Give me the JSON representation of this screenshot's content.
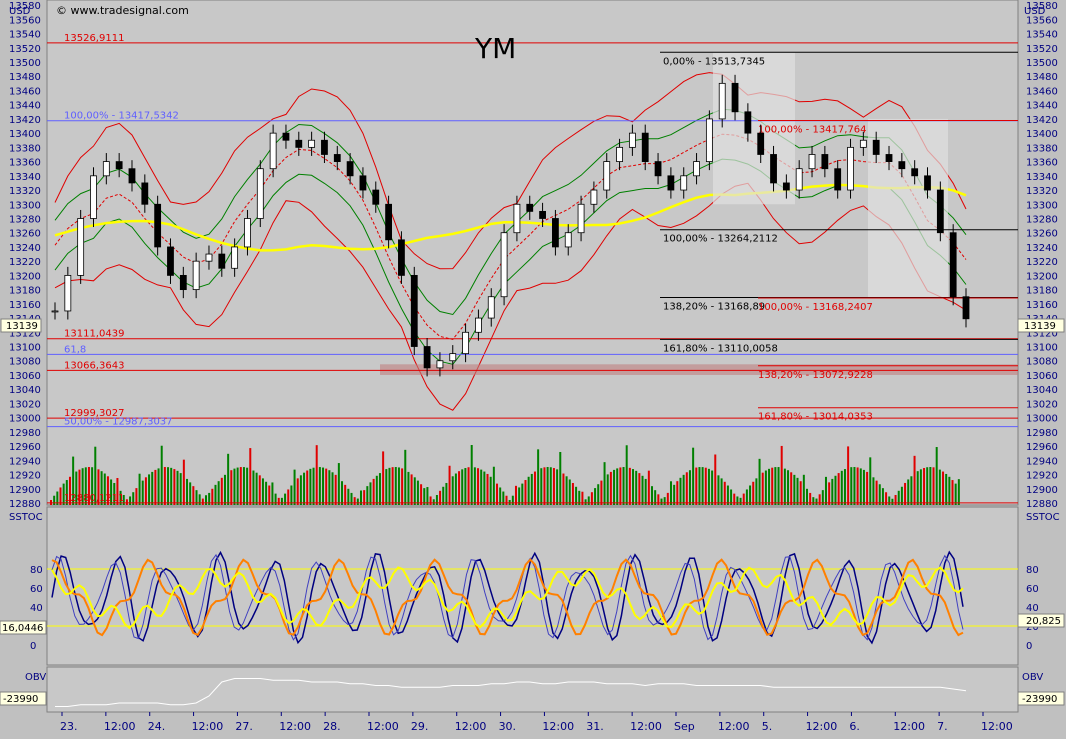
{
  "header": {
    "currency_left": "USD",
    "currency_right": "USD",
    "copyright": "© www.tradesignal.com",
    "symbol": "YM"
  },
  "price_panel": {
    "y_ticks": [
      13580,
      13560,
      13540,
      13520,
      13500,
      13480,
      13460,
      13440,
      13420,
      13400,
      13380,
      13360,
      13340,
      13320,
      13300,
      13280,
      13260,
      13240,
      13220,
      13200,
      13180,
      13160,
      13140,
      13120,
      13100,
      13080,
      13060,
      13040,
      13020,
      13000,
      12980,
      12960,
      12940,
      12920,
      12900,
      12880
    ],
    "current_price_label": "13139",
    "fib_levels": [
      {
        "label": "13526,9111",
        "value": 13526.9,
        "color": "#e00000",
        "style": "red"
      },
      {
        "label": "100,00% - 13417,5342",
        "value": 13417.5,
        "color": "#6060ff",
        "style": "blue"
      },
      {
        "label": "13111,0439",
        "value": 13111.0,
        "color": "#e00000",
        "style": "red"
      },
      {
        "label": "61,8",
        "value": 13089,
        "color": "#6060ff",
        "style": "blue"
      },
      {
        "label": "13066,3643",
        "value": 13066.4,
        "color": "#e00000",
        "style": "red"
      },
      {
        "label": "12999,3027",
        "value": 12999.3,
        "color": "#e00000",
        "style": "red"
      },
      {
        "label": "50,00% - 12987,3037",
        "value": 12987.3,
        "color": "#6060ff",
        "style": "blue"
      },
      {
        "label": "12880,1211",
        "value": 12880.1,
        "color": "#e00000",
        "style": "red"
      }
    ],
    "right_fibs": [
      {
        "label": "0,00% - 13513,7345",
        "value": 13513.7,
        "color": "#000000"
      },
      {
        "label": "100,00% - 13264,2112",
        "value": 13264.2,
        "color": "#000000"
      },
      {
        "label": "138,20% - 13168,89",
        "value": 13168.9,
        "color": "#000000"
      },
      {
        "label": "161,80% - 13110,0058",
        "value": 13110.0,
        "color": "#000000"
      }
    ],
    "right_fibs_red": [
      {
        "label": "100,00% - 13417,764",
        "value": 13417.8
      },
      {
        "label": "100,00% - 13168,2407",
        "value": 13168.2
      },
      {
        "label": "138,20% - 13072,9228",
        "value": 13072.9
      },
      {
        "label": "161,80% - 13014,0353",
        "value": 13014.0
      }
    ]
  },
  "sstoc_panel": {
    "title": "SSTOC",
    "y_ticks": [
      80,
      60,
      40,
      20,
      0
    ],
    "left_value": "16,0446",
    "right_value": "20,825"
  },
  "obv_panel": {
    "title": "OBV",
    "left_value": "-23990",
    "right_value": "-23990"
  },
  "time_axis": {
    "labels": [
      "23.",
      "12:00",
      "24.",
      "12:00",
      "27.",
      "12:00",
      "28.",
      "12:00",
      "29.",
      "12:00",
      "30.",
      "12:00",
      "31.",
      "12:00",
      "Sep",
      "12:00",
      "5.",
      "12:00",
      "6.",
      "12:00",
      "7.",
      "12:00"
    ]
  },
  "chart_data": {
    "type": "candlestick",
    "title": "YM",
    "ylabel": "USD",
    "ylim": [
      12880,
      13590
    ],
    "close_series": [
      13150,
      13200,
      13280,
      13340,
      13360,
      13350,
      13330,
      13300,
      13240,
      13200,
      13180,
      13220,
      13230,
      13210,
      13240,
      13280,
      13350,
      13400,
      13390,
      13380,
      13390,
      13370,
      13360,
      13340,
      13320,
      13300,
      13250,
      13200,
      13100,
      13070,
      13080,
      13090,
      13120,
      13140,
      13170,
      13260,
      13300,
      13290,
      13280,
      13240,
      13260,
      13300,
      13320,
      13360,
      13380,
      13400,
      13360,
      13340,
      13320,
      13340,
      13360,
      13420,
      13470,
      13430,
      13400,
      13370,
      13330,
      13320,
      13350,
      13370,
      13350,
      13320,
      13380,
      13390,
      13370,
      13360,
      13350,
      13340,
      13320,
      13260,
      13170,
      13139
    ],
    "sstoc_ylim": [
      0,
      100
    ],
    "obv_series": [
      12,
      12,
      13,
      13,
      13,
      14,
      14,
      14,
      14,
      13,
      13,
      14,
      18,
      26,
      28,
      28,
      28,
      27,
      27,
      27,
      26,
      26,
      26,
      25,
      25,
      24,
      24,
      23,
      23,
      23,
      23,
      24,
      24,
      24,
      25,
      25,
      26,
      26,
      25,
      25,
      26,
      26,
      26,
      25,
      25,
      25,
      24,
      25,
      25,
      25,
      24,
      24,
      24,
      24,
      24,
      24,
      23,
      23,
      23,
      23,
      23,
      23,
      23,
      23,
      23,
      23,
      23,
      23,
      23,
      23,
      22,
      21
    ]
  }
}
